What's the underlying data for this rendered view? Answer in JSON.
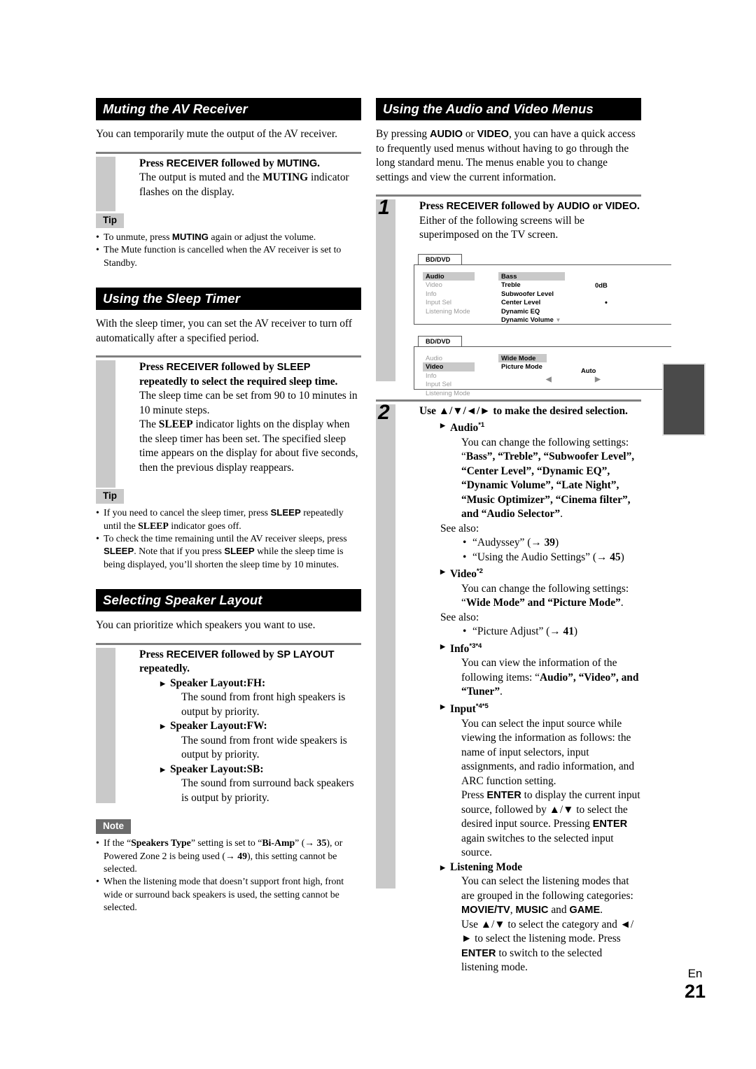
{
  "page": {
    "language_label": "En",
    "number": "21"
  },
  "left_column": {
    "muting": {
      "heading": "Muting the AV Receiver",
      "intro": "You can temporarily mute the output of the AV receiver.",
      "step_title_pre": "Press ",
      "step_key1": "RECEIVER",
      "step_mid": " followed by ",
      "step_key2": "MUTING",
      "step_end": ".",
      "step_body_a": "The output is muted and the ",
      "step_body_key": "MUTING",
      "step_body_b": " indicator flashes on the display.",
      "tip_label": "Tip",
      "tips": [
        {
          "a": "To unmute, press ",
          "key": "MUTING",
          "b": " again or adjust the volume."
        },
        {
          "a": "The Mute function is cancelled when the AV receiver is set to Standby.",
          "key": "",
          "b": ""
        }
      ]
    },
    "sleep": {
      "heading": "Using the Sleep Timer",
      "intro": "With the sleep timer, you can set the AV receiver to turn off automatically after a specified period.",
      "step_title_pre": "Press ",
      "step_key1": "RECEIVER",
      "step_mid": " followed by ",
      "step_key2": "SLEEP",
      "step_title_post": " repeatedly to select the required sleep time.",
      "body_p1": "The sleep time can be set from 90 to 10 minutes in 10 minute steps.",
      "body_p2_a": "The ",
      "body_p2_key": "SLEEP",
      "body_p2_b": " indicator lights on the display when the sleep timer has been set. The specified sleep time appears on the display for about five seconds, then the previous display reappears.",
      "tip_label": "Tip",
      "tip1_a": "If you need to cancel the sleep timer, press ",
      "tip1_key1": "SLEEP",
      "tip1_b": " repeatedly until the ",
      "tip1_key2": "SLEEP",
      "tip1_c": " indicator goes off.",
      "tip2_a": "To check the time remaining until the AV receiver sleeps, press ",
      "tip2_key1": "SLEEP",
      "tip2_b": ". Note that if you press ",
      "tip2_key2": "SLEEP",
      "tip2_c": " while the sleep time is being displayed, you’ll shorten the sleep time by 10 minutes."
    },
    "speaker_layout": {
      "heading": "Selecting Speaker Layout",
      "intro": "You can prioritize which speakers you want to use.",
      "step_title_pre": "Press ",
      "step_key1": "RECEIVER",
      "step_mid": " followed by ",
      "step_key2": "SP LAYOUT",
      "step_title_post": " repeatedly.",
      "items": [
        {
          "label": "Speaker Layout:FH:",
          "text": "The sound from front high speakers is output by priority."
        },
        {
          "label": "Speaker Layout:FW:",
          "text": "The sound from front wide speakers is output by priority."
        },
        {
          "label": "Speaker Layout:SB:",
          "text": "The sound from surround back speakers is output by priority."
        }
      ],
      "note_label": "Note",
      "note1_a": "If the “",
      "note1_b1": "Speakers Type",
      "note1_b": "” setting is set to “",
      "note1_b2": "Bi-Amp",
      "note1_c": "” (→ ",
      "note1_p1": "35",
      "note1_d": "), or Powered Zone 2 is being used (→ ",
      "note1_p2": "49",
      "note1_e": "), this setting cannot be selected.",
      "note2": "When the listening mode that doesn’t support front high, front wide or surround back speakers is used, the setting cannot be selected."
    }
  },
  "right_column": {
    "av_menus": {
      "heading": "Using the Audio and Video Menus",
      "intro_a": "By pressing ",
      "intro_key1": "AUDIO",
      "intro_b": " or ",
      "intro_key2": "VIDEO",
      "intro_c": ", you can have a quick access to frequently used menus without having to go through the long standard menu. The menus enable you to change settings and view the current information.",
      "step1_num": "1",
      "step1_title_pre": "Press ",
      "step1_key1": "RECEIVER",
      "step1_mid": " followed by ",
      "step1_key2": "AUDIO",
      "step1_or": " or ",
      "step1_key3": "VIDEO",
      "step1_end": ".",
      "step1_body": "Either of the following screens will be superimposed on the TV screen.",
      "osd_audio": {
        "tab": "BD/DVD",
        "menu": [
          "Audio",
          "Video",
          "Info",
          "Input Sel",
          "Listening Mode"
        ],
        "selected_menu": "Audio",
        "submenu": [
          "Bass",
          "Treble",
          "Subwoofer Level",
          "Center Level",
          "Dynamic EQ",
          "Dynamic Volume"
        ],
        "selected_submenu": "Bass",
        "value_db": "0dB",
        "value_dot": "•",
        "scroll_icon": "triangle-down-icon"
      },
      "osd_video": {
        "tab": "BD/DVD",
        "menu": [
          "Audio",
          "Video",
          "Info",
          "Input Sel",
          "Listening Mode"
        ],
        "selected_menu": "Video",
        "submenu": [
          "Wide Mode",
          "Picture Mode"
        ],
        "selected_submenu": "Wide Mode",
        "value": "Auto",
        "left_icon": "triangle-left-icon",
        "right_icon": "triangle-right-icon"
      },
      "step2_num": "2",
      "step2_title": "Use ▲/▼/◄/► to make the desired selection.",
      "audio": {
        "label": "Audio",
        "sup": "*1",
        "text_a": "You can change the following settings: “",
        "settings": "Bass”, “Treble”, “Subwoofer Level”, “Center Level”, “Dynamic EQ”, “Dynamic Volume”, “Late Night”, “Music Optimizer”, “Cinema filter”, and “Audio Selector”",
        "text_b": ".",
        "see_also": "See also:",
        "links": [
          {
            "text": "“Audyssey” (→ ",
            "page": "39",
            "tail": ")"
          },
          {
            "text": "“Using the Audio Settings” (→ ",
            "page": "45",
            "tail": ")"
          }
        ]
      },
      "video": {
        "label": "Video",
        "sup": "*2",
        "text_a": "You can change the following settings: “",
        "settings": "Wide Mode” and “Picture Mode”",
        "text_b": ".",
        "see_also": "See also:",
        "links": [
          {
            "text": "“Picture Adjust” (→ ",
            "page": "41",
            "tail": ")"
          }
        ]
      },
      "info": {
        "label": "Info",
        "sup": "*3*4",
        "text_a": "You can view the information of the following items: “",
        "items": "Audio”, “Video”, and “Tuner”",
        "text_b": "."
      },
      "input": {
        "label": "Input",
        "sup": "*4*5",
        "p1": "You can select the input source while viewing the information as follows: the name of input selectors, input assignments, and radio information, and ARC function setting.",
        "p2_a": "Press ",
        "p2_key1": "ENTER",
        "p2_b": " to display the current input source, followed by ▲/▼ to select the desired input source. Pressing ",
        "p2_key2": "ENTER",
        "p2_c": " again switches to the selected input source."
      },
      "listening_mode": {
        "label": "Listening Mode",
        "p1_a": "You can select the listening modes that are grouped in the following categories: ",
        "cat1": "MOVIE/TV",
        "p1_b": ", ",
        "cat2": "MUSIC",
        "p1_c": " and ",
        "cat3": "GAME",
        "p1_d": ".",
        "p2_a": "Use ▲/▼ to select the category and ◄/► to select the listening mode. Press ",
        "p2_key": "ENTER",
        "p2_b": " to switch to the selected listening mode."
      }
    }
  }
}
